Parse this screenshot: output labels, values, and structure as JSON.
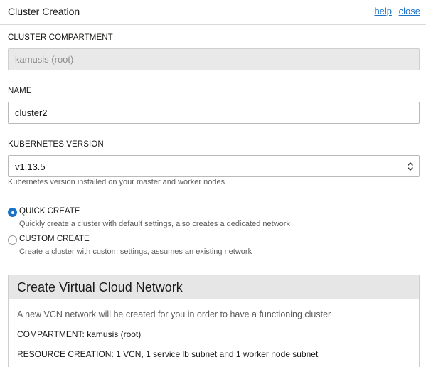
{
  "header": {
    "title": "Cluster Creation",
    "help_link": "help",
    "close_link": "close"
  },
  "compartment": {
    "label": "CLUSTER COMPARTMENT",
    "value": "kamusis (root)"
  },
  "name": {
    "label": "NAME",
    "value": "cluster2"
  },
  "kubernetes": {
    "label": "KUBERNETES VERSION",
    "selected": "v1.13.5",
    "help": "Kubernetes version installed on your master and worker nodes"
  },
  "creation_mode": {
    "quick": {
      "label": "QUICK CREATE",
      "description": "Quickly create a cluster with default settings, also creates a dedicated network",
      "checked": true
    },
    "custom": {
      "label": "CUSTOM CREATE",
      "description": "Create a cluster with custom settings, assumes an existing network",
      "checked": false
    }
  },
  "vcn": {
    "title": "Create Virtual Cloud Network",
    "description": "A new VCN network will be created for you in order to have a functioning cluster",
    "compartment_line": "COMPARTMENT: kamusis (root)",
    "resource_line": "RESOURCE CREATION: 1 VCN, 1 service lb subnet and 1 worker node subnet"
  },
  "colors": {
    "accent": "#1a73c9",
    "panel_header": "#e6e6e6"
  }
}
